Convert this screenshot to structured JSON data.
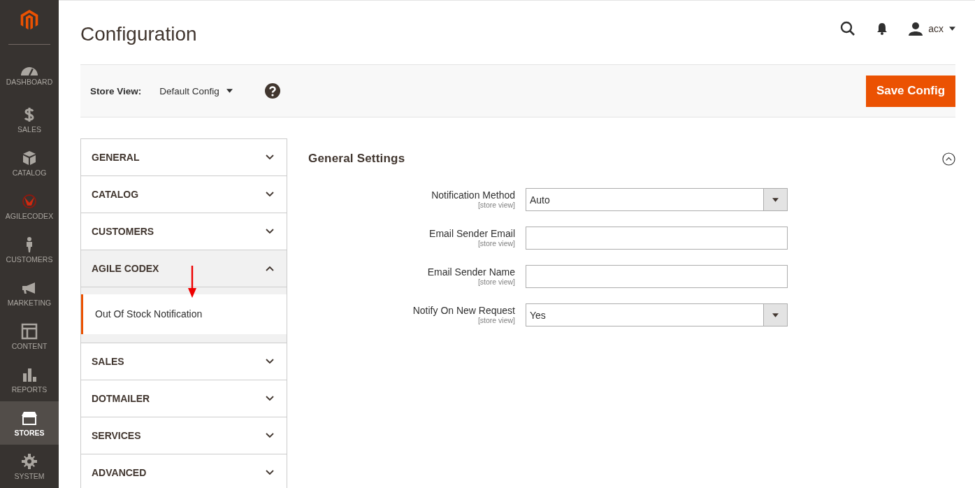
{
  "sidebar": {
    "items": [
      {
        "label": "DASHBOARD",
        "selected": false
      },
      {
        "label": "SALES",
        "selected": false
      },
      {
        "label": "CATALOG",
        "selected": false
      },
      {
        "label": "AGILECODEX",
        "selected": false
      },
      {
        "label": "CUSTOMERS",
        "selected": false
      },
      {
        "label": "MARKETING",
        "selected": false
      },
      {
        "label": "CONTENT",
        "selected": false
      },
      {
        "label": "REPORTS",
        "selected": false
      },
      {
        "label": "STORES",
        "selected": true
      },
      {
        "label": "SYSTEM",
        "selected": false
      }
    ]
  },
  "header": {
    "title": "Configuration",
    "user": "acx"
  },
  "store_view": {
    "label": "Store View:",
    "value": "Default Config",
    "save_button": "Save Config"
  },
  "sections": [
    {
      "title": "GENERAL",
      "expanded": false
    },
    {
      "title": "CATALOG",
      "expanded": false
    },
    {
      "title": "CUSTOMERS",
      "expanded": false
    },
    {
      "title": "AGILE CODEX",
      "expanded": true,
      "children": [
        {
          "label": "Out Of Stock Notification",
          "selected": true
        }
      ]
    },
    {
      "title": "SALES",
      "expanded": false
    },
    {
      "title": "DOTMAILER",
      "expanded": false
    },
    {
      "title": "SERVICES",
      "expanded": false
    },
    {
      "title": "ADVANCED",
      "expanded": false
    }
  ],
  "group": {
    "title": "General Settings",
    "expanded": true,
    "fields": [
      {
        "kind": "select",
        "label": "Notification Method",
        "scope": "[store view]",
        "value": "Auto"
      },
      {
        "kind": "text",
        "label": "Email Sender Email",
        "scope": "[store view]"
      },
      {
        "kind": "text",
        "label": "Email Sender Name",
        "scope": "[store view]"
      },
      {
        "kind": "select",
        "label": "Notify On New Request",
        "scope": "[store view]",
        "value": "Yes"
      }
    ]
  }
}
